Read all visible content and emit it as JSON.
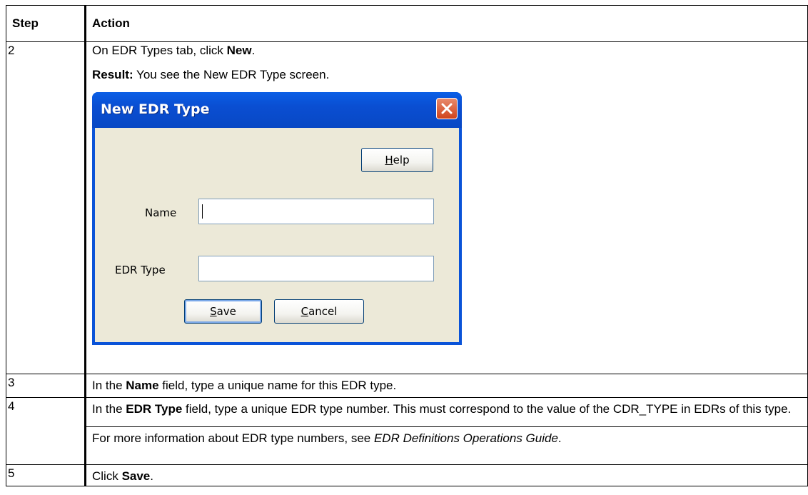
{
  "table": {
    "header": {
      "step": "Step",
      "action": "Action"
    },
    "rows": [
      {
        "step": "2",
        "line1_pre": "On EDR Types tab, click ",
        "line1_bold": "New",
        "line1_post": ".",
        "line2_bold": "Result:",
        "line2_post": " You see the New EDR Type screen."
      },
      {
        "step": "3",
        "pre": "In the ",
        "bold": "Name",
        "post": " field, type a unique name for this EDR type."
      },
      {
        "step": "4",
        "pre": "In the ",
        "bold": "EDR Type",
        "post": " field, type a unique EDR type number. This must correspond to the value of the CDR_TYPE in EDRs of this type.",
        "note_pre": "For more information about EDR type numbers, see ",
        "note_italic": "EDR Definitions Operations Guide",
        "note_post": "."
      },
      {
        "step": "5",
        "pre": "Click ",
        "bold": "Save",
        "post": "."
      }
    ]
  },
  "dialog": {
    "title": "New EDR Type",
    "help_hotkey": "H",
    "help_rest": "elp",
    "name_label": "Name",
    "name_value": "",
    "edr_type_label": "EDR Type",
    "edr_type_value": "",
    "save_hotkey": "S",
    "save_rest": "ave",
    "cancel_hotkey": "C",
    "cancel_rest": "ancel",
    "close_icon": "close-x",
    "colors": {
      "titlebar": "#0a53d8",
      "body": "#ece9d8",
      "close": "#d0431c"
    }
  }
}
